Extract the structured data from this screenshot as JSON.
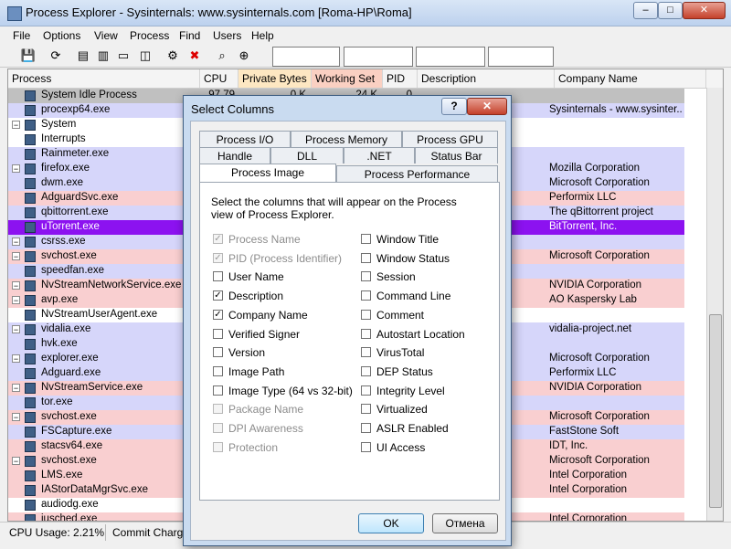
{
  "window": {
    "title": "Process Explorer - Sysinternals: www.sysinternals.com [Roma-HP\\Roma]",
    "minimize": "–",
    "maximize": "□",
    "close": "✕"
  },
  "menu": [
    "File",
    "Options",
    "View",
    "Process",
    "Find",
    "Users",
    "Help"
  ],
  "columns": [
    "Process",
    "CPU",
    "Private Bytes",
    "Working Set",
    "PID",
    "Description",
    "Company Name"
  ],
  "colors": {
    "pink": "#f9cfd0",
    "lavender": "#d6d6fa",
    "purple": "#8c12f0",
    "gray": "#c0c0c0",
    "white": "#ffffff"
  },
  "processes": [
    {
      "name": "System Idle Process",
      "cpu": "97.79",
      "pb": "0 K",
      "ws": "24 K",
      "pid": "0",
      "desc": "",
      "company": "",
      "color": "gray",
      "icon": "app-icon"
    },
    {
      "name": "procexp64.exe",
      "cpu": "",
      "pb": "",
      "ws": "",
      "pid": "",
      "desc": "xplorer",
      "company": "Sysinternals - www.sysinter...",
      "color": "lavender",
      "icon": "procexp-icon"
    },
    {
      "name": "System",
      "cpu": "",
      "pb": "",
      "ws": "",
      "pid": "",
      "desc": "",
      "company": "",
      "color": "white",
      "tree": "−",
      "icon": "app-icon"
    },
    {
      "name": "Interrupts",
      "cpu": "",
      "pb": "",
      "ws": "",
      "pid": "",
      "desc": "d DPCs",
      "company": "",
      "color": "white",
      "icon": "app-icon"
    },
    {
      "name": "Rainmeter.exe",
      "cpu": "",
      "pb": "",
      "ws": "",
      "pid": "",
      "desc": "",
      "company": "",
      "color": "lavender",
      "icon": "drop-icon"
    },
    {
      "name": "firefox.exe",
      "cpu": "",
      "pb": "",
      "ws": "",
      "pid": "",
      "desc": "",
      "company": "Mozilla Corporation",
      "color": "lavender",
      "tree": "−",
      "icon": "firefox-icon"
    },
    {
      "name": "dwm.exe",
      "cpu": "",
      "pb": "",
      "ws": "",
      "pid": "",
      "desc": "чего ...",
      "company": "Microsoft Corporation",
      "color": "lavender",
      "icon": "app-icon"
    },
    {
      "name": "AdguardSvc.exe",
      "cpu": "",
      "pb": "",
      "ws": "",
      "pid": "",
      "desc": "",
      "company": "Performix LLC",
      "color": "pink",
      "icon": "shield-icon"
    },
    {
      "name": "qbittorrent.exe",
      "cpu": "",
      "pb": "",
      "ws": "",
      "pid": "",
      "desc": "Client",
      "company": "The qBittorrent project",
      "color": "lavender",
      "icon": "qbittorrent-icon"
    },
    {
      "name": "uTorrent.exe",
      "cpu": "",
      "pb": "",
      "ws": "",
      "pid": "",
      "desc": "",
      "company": "BitTorrent, Inc.",
      "color": "purple",
      "icon": "utorrent-icon"
    },
    {
      "name": "csrss.exe",
      "cpu": "",
      "pb": "",
      "ws": "",
      "pid": "",
      "desc": "",
      "company": "",
      "color": "lavender",
      "tree": "−",
      "icon": "app-icon"
    },
    {
      "name": "svchost.exe",
      "cpu": "",
      "pb": "",
      "ws": "",
      "pid": "",
      "desc": "жб ...",
      "company": "Microsoft Corporation",
      "color": "pink",
      "tree": "−",
      "icon": "app-icon"
    },
    {
      "name": "speedfan.exe",
      "cpu": "",
      "pb": "",
      "ws": "",
      "pid": "",
      "desc": "",
      "company": "",
      "color": "lavender",
      "icon": "app-icon"
    },
    {
      "name": "NvStreamNetworkService.exe",
      "cpu": "",
      "pb": "",
      "ws": "",
      "pid": "",
      "desc": "m Ser...",
      "company": "NVIDIA Corporation",
      "color": "pink",
      "tree": "−",
      "icon": "app-icon"
    },
    {
      "name": "avp.exe",
      "cpu": "",
      "pb": "",
      "ws": "",
      "pid": "",
      "desc": "",
      "company": "AO Kaspersky Lab",
      "color": "pink",
      "tree": "−",
      "icon": "kaspersky-icon"
    },
    {
      "name": "NvStreamUserAgent.exe",
      "cpu": "",
      "pb": "",
      "ws": "",
      "pid": "",
      "desc": "",
      "company": "",
      "color": "white",
      "icon": "app-icon"
    },
    {
      "name": "vidalia.exe",
      "cpu": "",
      "pb": "",
      "ws": "",
      "pid": "",
      "desc": "",
      "company": "vidalia-project.net",
      "color": "lavender",
      "tree": "−",
      "icon": "onion-icon"
    },
    {
      "name": "hvk.exe",
      "cpu": "",
      "pb": "",
      "ws": "",
      "pid": "",
      "desc": "",
      "company": "",
      "color": "lavender",
      "icon": "app-icon"
    },
    {
      "name": "explorer.exe",
      "cpu": "",
      "pb": "",
      "ws": "",
      "pid": "",
      "desc": "",
      "company": "Microsoft Corporation",
      "color": "lavender",
      "tree": "−",
      "icon": "folder-icon"
    },
    {
      "name": "Adguard.exe",
      "cpu": "",
      "pb": "",
      "ws": "",
      "pid": "",
      "desc": "",
      "company": "Performix LLC",
      "color": "lavender",
      "icon": "shield-icon"
    },
    {
      "name": "NvStreamService.exe",
      "cpu": "",
      "pb": "",
      "ws": "",
      "pid": "",
      "desc": "ce",
      "company": "NVIDIA Corporation",
      "color": "pink",
      "tree": "−",
      "icon": "app-icon"
    },
    {
      "name": "tor.exe",
      "cpu": "",
      "pb": "",
      "ws": "",
      "pid": "",
      "desc": "",
      "company": "",
      "color": "lavender",
      "icon": "app-icon"
    },
    {
      "name": "svchost.exe",
      "cpu": "",
      "pb": "",
      "ws": "",
      "pid": "",
      "desc": "жб ...",
      "company": "Microsoft Corporation",
      "color": "pink",
      "tree": "−",
      "icon": "app-icon"
    },
    {
      "name": "FSCapture.exe",
      "cpu": "",
      "pb": "",
      "ws": "",
      "pid": "",
      "desc": "",
      "company": "FastStone Soft",
      "color": "lavender",
      "icon": "fscapture-icon"
    },
    {
      "name": "stacsv64.exe",
      "cpu": "",
      "pb": "",
      "ws": "",
      "pid": "",
      "desc": "",
      "company": "IDT, Inc.",
      "color": "pink",
      "icon": "music-icon"
    },
    {
      "name": "svchost.exe",
      "cpu": "",
      "pb": "",
      "ws": "",
      "pid": "",
      "desc": "жб ...",
      "company": "Microsoft Corporation",
      "color": "pink",
      "tree": "−",
      "icon": "app-icon"
    },
    {
      "name": "LMS.exe",
      "cpu": "",
      "pb": "",
      "ws": "",
      "pid": "",
      "desc": "rvice",
      "company": "Intel Corporation",
      "color": "pink",
      "icon": "app-icon"
    },
    {
      "name": "IAStorDataMgrSvc.exe",
      "cpu": "",
      "pb": "",
      "ws": "",
      "pid": "",
      "desc": "",
      "company": "Intel Corporation",
      "color": "pink",
      "icon": "app-icon"
    },
    {
      "name": "audiodg.exe",
      "cpu": "",
      "pb": "",
      "ws": "",
      "pid": "",
      "desc": "",
      "company": "",
      "color": "white",
      "icon": "app-icon"
    },
    {
      "name": "jusched.exe",
      "cpu": "",
      "pb": "",
      "ws": "",
      "pid": "",
      "desc": "",
      "company": "Intel Corporation",
      "color": "pink",
      "icon": "app-icon"
    }
  ],
  "status": {
    "cpu": "CPU Usage: 2.21%",
    "commit": "Commit Charg"
  },
  "dialog": {
    "title": "Select Columns",
    "help": "?",
    "close": "✕",
    "tabs_row1": [
      "Process I/O",
      "Process Memory",
      "Process GPU"
    ],
    "tabs_row2": [
      "Handle",
      "DLL",
      ".NET",
      "Status Bar"
    ],
    "tabs_row3": [
      "Process Image",
      "Process Performance"
    ],
    "instructions": "Select the columns that will appear on the Process view of Process Explorer.",
    "left_options": [
      {
        "label": "Process Name",
        "checked": true,
        "disabled": true
      },
      {
        "label": "PID (Process Identifier)",
        "checked": true,
        "disabled": true
      },
      {
        "label": "User Name",
        "checked": false,
        "disabled": false
      },
      {
        "label": "Description",
        "checked": true,
        "disabled": false
      },
      {
        "label": "Company Name",
        "checked": true,
        "disabled": false
      },
      {
        "label": "Verified Signer",
        "checked": false,
        "disabled": false
      },
      {
        "label": "Version",
        "checked": false,
        "disabled": false
      },
      {
        "label": "Image Path",
        "checked": false,
        "disabled": false
      },
      {
        "label": "Image Type (64 vs 32-bit)",
        "checked": false,
        "disabled": false
      },
      {
        "label": "Package Name",
        "checked": false,
        "disabled": true
      },
      {
        "label": "DPI Awareness",
        "checked": false,
        "disabled": true
      },
      {
        "label": "Protection",
        "checked": false,
        "disabled": true
      }
    ],
    "right_options": [
      {
        "label": "Window Title",
        "checked": false,
        "disabled": false
      },
      {
        "label": "Window Status",
        "checked": false,
        "disabled": false
      },
      {
        "label": "Session",
        "checked": false,
        "disabled": false
      },
      {
        "label": "Command Line",
        "checked": false,
        "disabled": false
      },
      {
        "label": "Comment",
        "checked": false,
        "disabled": false
      },
      {
        "label": "Autostart Location",
        "checked": false,
        "disabled": false
      },
      {
        "label": "VirusTotal",
        "checked": false,
        "disabled": false
      },
      {
        "label": "DEP Status",
        "checked": false,
        "disabled": false
      },
      {
        "label": "Integrity Level",
        "checked": false,
        "disabled": false
      },
      {
        "label": "Virtualized",
        "checked": false,
        "disabled": false
      },
      {
        "label": "ASLR Enabled",
        "checked": false,
        "disabled": false
      },
      {
        "label": "UI Access",
        "checked": false,
        "disabled": false
      }
    ],
    "ok": "OK",
    "cancel": "Отмена"
  }
}
